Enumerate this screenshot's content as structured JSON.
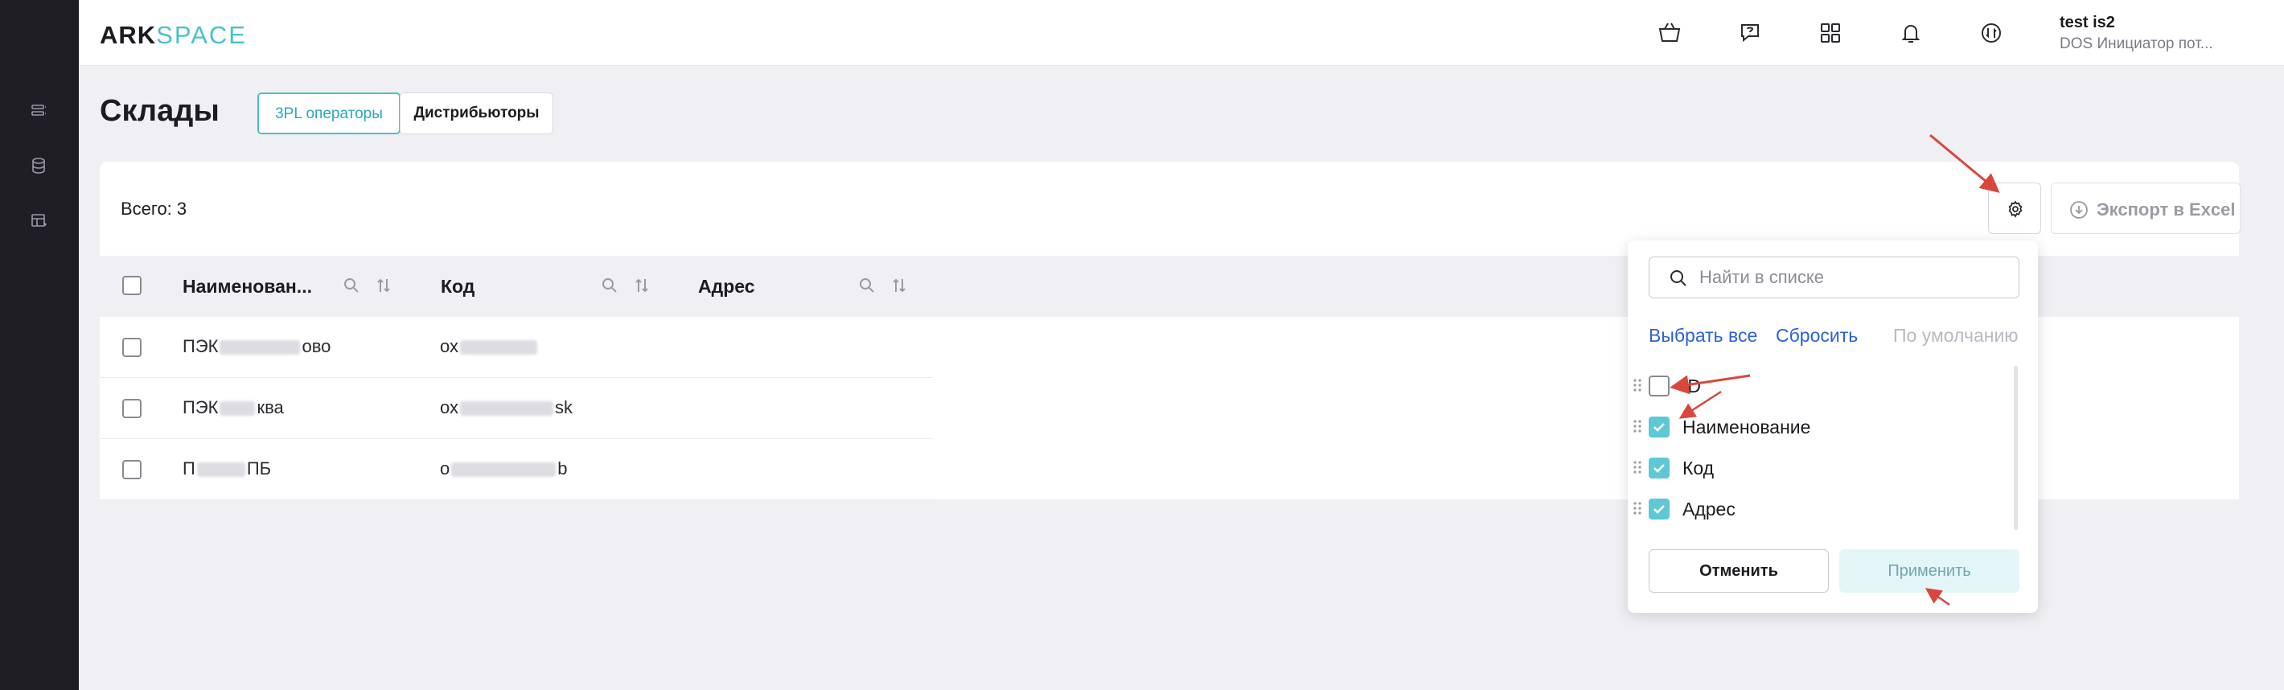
{
  "header": {
    "logo_part1": "ARK",
    "logo_part2": "SPACE",
    "user_name": "test is2",
    "user_role": "DOS Инициатор пот..."
  },
  "sidebar": {
    "icons": [
      "list-icon",
      "database-icon",
      "table-icon"
    ]
  },
  "page": {
    "title": "Склады",
    "tabs": [
      {
        "label": "3PL операторы",
        "active": true
      },
      {
        "label": "Дистрибьюторы",
        "active": false
      }
    ]
  },
  "toolbar": {
    "total": "Всего: 3",
    "export_label": "Экспорт в Excel"
  },
  "table": {
    "columns": [
      "Наименован...",
      "Код",
      "Адрес"
    ],
    "rows": [
      {
        "name_a": "ПЭК",
        "name_b": "ово",
        "code_a": "ох",
        "code_b": ""
      },
      {
        "name_a": "ПЭК",
        "name_b": "ква",
        "code_a": "ох",
        "code_b": "sk"
      },
      {
        "name_a": "П",
        "name_b": "ПБ",
        "code_a": "о",
        "code_b": "b"
      }
    ]
  },
  "column_settings": {
    "search_placeholder": "Найти в списке",
    "select_all": "Выбрать все",
    "reset": "Сбросить",
    "default": "По умолчанию",
    "options": [
      {
        "label": "ID",
        "checked": false
      },
      {
        "label": "Наименование",
        "checked": true
      },
      {
        "label": "Код",
        "checked": true
      },
      {
        "label": "Адрес",
        "checked": true
      }
    ],
    "cancel": "Отменить",
    "apply": "Применить"
  },
  "colors": {
    "accent": "#47c1cf",
    "link": "#2a61d8",
    "annotation": "#d9463b"
  }
}
